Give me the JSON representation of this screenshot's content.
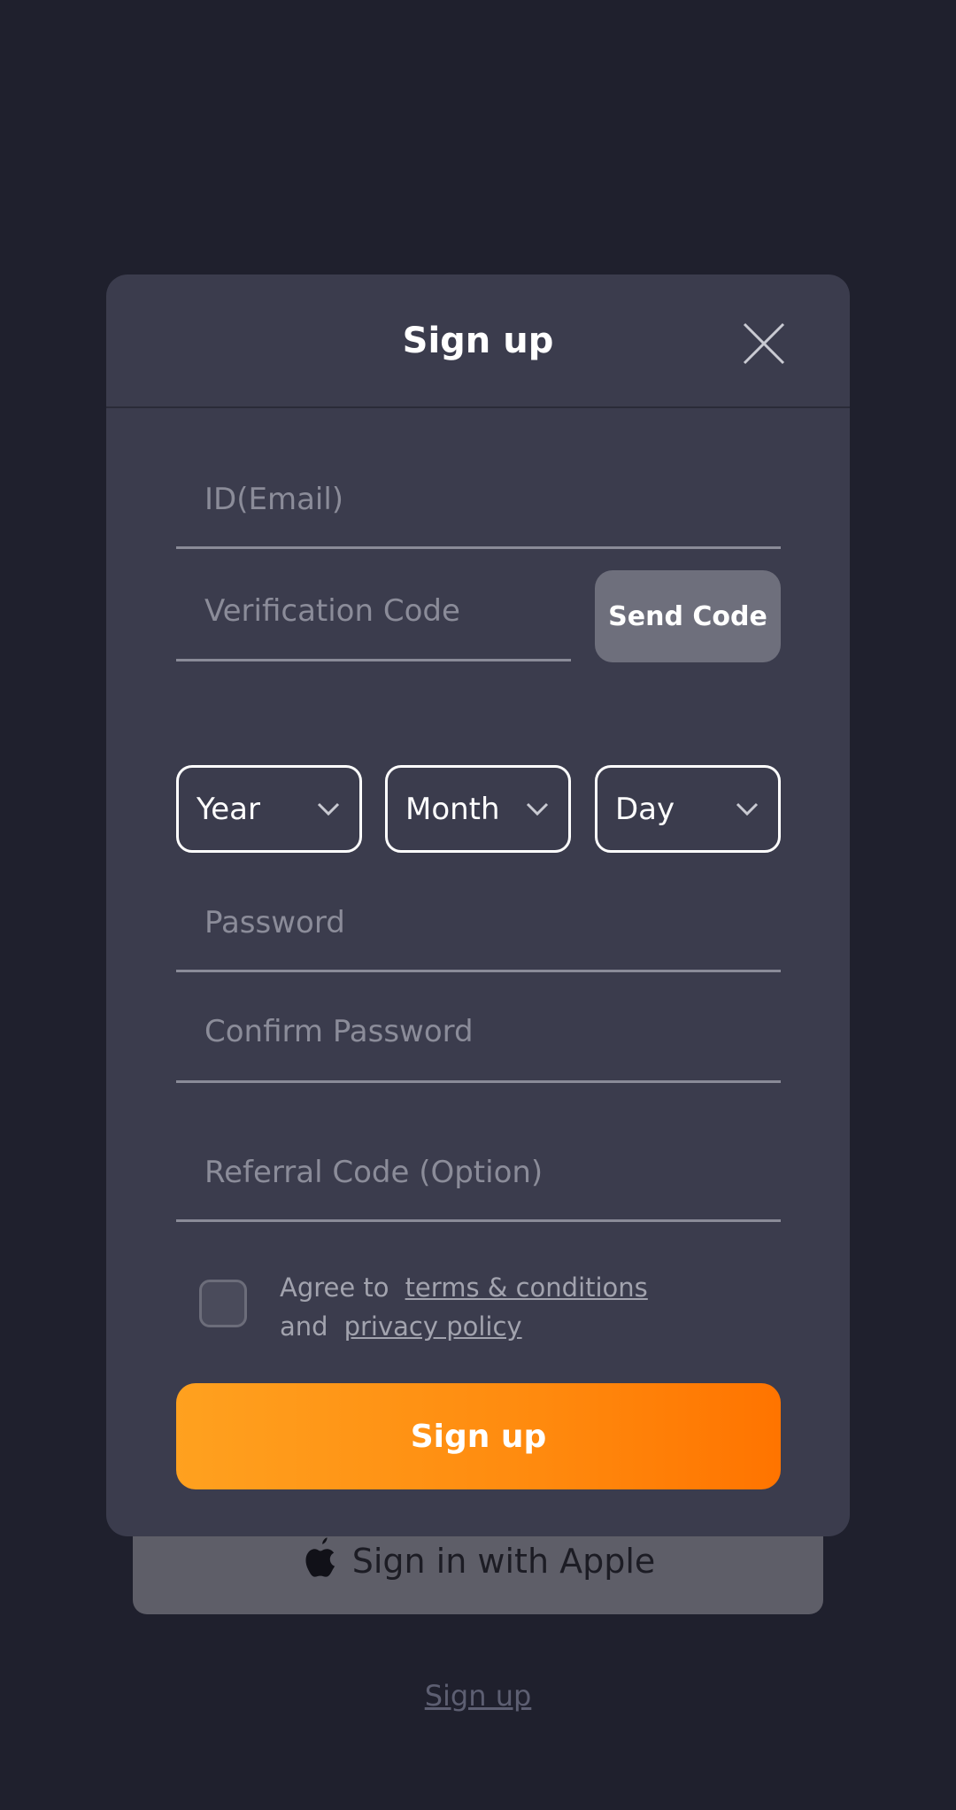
{
  "modal": {
    "title": "Sign up",
    "fields": {
      "email_placeholder": "ID(Email)",
      "code_placeholder": "Verification Code",
      "password_placeholder": "Password",
      "confirm_placeholder": "Confirm Password",
      "referral_placeholder": "Referral Code (Option)"
    },
    "send_code_label": "Send Code",
    "birthdate": {
      "year": "Year",
      "month": "Month",
      "day": "Day"
    },
    "agree": {
      "prefix": "Agree to",
      "terms": "terms & conditions",
      "and": "and",
      "privacy": "privacy policy"
    },
    "submit_label": "Sign up"
  },
  "background": {
    "apple_label": "Sign in with Apple",
    "signup_link": "Sign up"
  },
  "colors": {
    "accent_start": "#ffa11f",
    "accent_end": "#ff7400",
    "modal_bg": "#3b3c4d",
    "page_bg": "#1f202d"
  }
}
